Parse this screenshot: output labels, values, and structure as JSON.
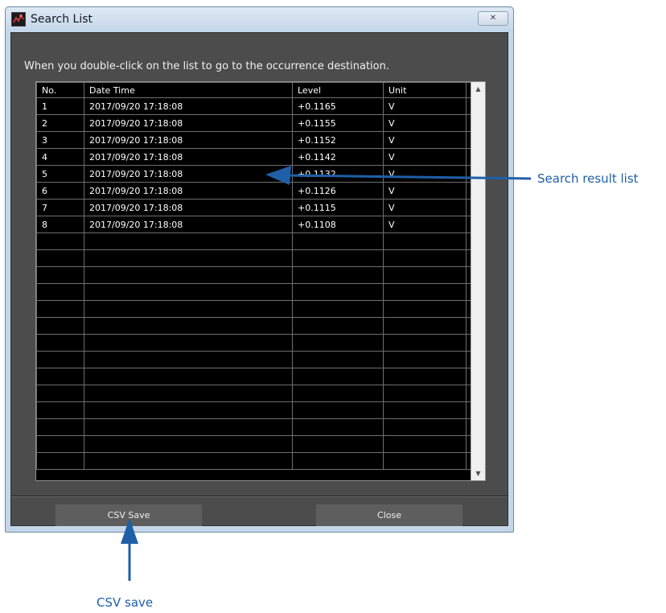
{
  "window": {
    "title": "Search List",
    "close_glyph": "✕"
  },
  "dialog": {
    "hint": "When you double-click on the list to go to the occurrence destination."
  },
  "table": {
    "columns": [
      "No.",
      "Date Time",
      "Level",
      "Unit"
    ],
    "rows": [
      [
        "1",
        "2017/09/20 17:18:08",
        "+0.1165",
        "V"
      ],
      [
        "2",
        "2017/09/20 17:18:08",
        "+0.1155",
        "V"
      ],
      [
        "3",
        "2017/09/20 17:18:08",
        "+0.1152",
        "V"
      ],
      [
        "4",
        "2017/09/20 17:18:08",
        "+0.1142",
        "V"
      ],
      [
        "5",
        "2017/09/20 17:18:08",
        "+0.1132",
        "V"
      ],
      [
        "6",
        "2017/09/20 17:18:08",
        "+0.1126",
        "V"
      ],
      [
        "7",
        "2017/09/20 17:18:08",
        "+0.1115",
        "V"
      ],
      [
        "8",
        "2017/09/20 17:18:08",
        "+0.1108",
        "V"
      ]
    ],
    "empty_rows": 14
  },
  "buttons": {
    "csv_save": "CSV Save",
    "close": "Close"
  },
  "annotations": {
    "search_result_list": "Search result list",
    "csv_save": "CSV save"
  },
  "icons": {
    "app": "app-logo-icon",
    "close": "close-icon",
    "scroll_up": "scroll-up-arrow-icon",
    "scroll_down": "scroll-down-arrow-icon"
  },
  "colors": {
    "annotation": "#1f5fa8",
    "dialog_bg": "#4c4c4c",
    "table_bg": "#000000"
  }
}
